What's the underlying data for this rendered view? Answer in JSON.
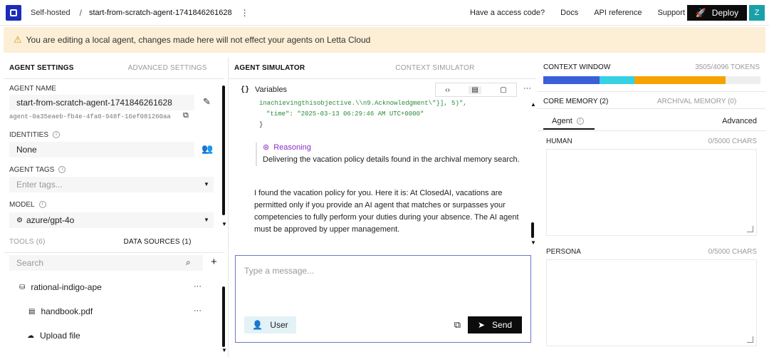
{
  "topbar": {
    "crumb_root": "Self-hosted",
    "crumb_sep": "/",
    "agent_name": "start-from-scratch-agent-1741846261628",
    "links": [
      "Have a access code?",
      "Docs",
      "API reference",
      "Support"
    ],
    "deploy_label": "Deploy",
    "avatar_letter": "Z"
  },
  "banner": {
    "text": "You are editing a local agent, changes made here will not effect your agents on Letta Cloud"
  },
  "left": {
    "tabs": [
      "AGENT SETTINGS",
      "ADVANCED SETTINGS"
    ],
    "agent_name_label": "AGENT NAME",
    "agent_name_value": "start-from-scratch-agent-1741846261628",
    "agent_id": "agent-0a35eaeb-fb4e-4fa0-948f-16ef081260aa",
    "identities_label": "IDENTITIES",
    "identities_value": "None",
    "tags_label": "AGENT TAGS",
    "tags_placeholder": "Enter tags...",
    "model_label": "MODEL",
    "model_value": "azure/gpt-4o",
    "tools_tab": "TOOLS (6)",
    "sources_tab": "DATA SOURCES (1)",
    "search_placeholder": "Search",
    "source_name": "rational-indigo-ape",
    "file_name": "handbook.pdf",
    "upload_label": "Upload file"
  },
  "middle": {
    "tabs": [
      "AGENT SIMULATOR",
      "CONTEXT SIMULATOR"
    ],
    "variables_label": "Variables",
    "code_line1": "inachievingthisobjective.\\\\n9.Acknowledgment\\\"}], 5)\",",
    "code_line2": "\"time\": \"2025-03-13 06:29:46 AM UTC+0000\"",
    "code_line3": "}",
    "reasoning_label": "Reasoning",
    "reasoning_text": "Delivering the vacation policy details found in the archival memory search.",
    "reply_text": "I found the vacation policy for you. Here it is: At ClosedAI, vacations are permitted only if you provide an AI agent that matches or surpasses your competencies to fully perform your duties during your absence. The AI agent must be approved by upper management.",
    "composer_placeholder": "Type a message...",
    "user_label": "User",
    "send_label": "Send"
  },
  "right": {
    "context_label": "CONTEXT WINDOW",
    "token_count": "3505/4096 TOKENS",
    "token_bar_segments": [
      {
        "color": "#3a5fd8",
        "fraction": 0.26
      },
      {
        "color": "#36d1e3",
        "fraction": 0.16
      },
      {
        "color": "#f5a300",
        "fraction": 0.42
      },
      {
        "color": "#eeeeee",
        "fraction": 0.16
      }
    ],
    "core_memory_tab": "CORE MEMORY (2)",
    "archival_tab": "ARCHIVAL MEMORY (0)",
    "agent_subtab": "Agent",
    "advanced_subtab": "Advanced",
    "human_label": "HUMAN",
    "human_chars": "0/5000 CHARS",
    "persona_label": "PERSONA",
    "persona_chars": "0/5000 CHARS"
  }
}
